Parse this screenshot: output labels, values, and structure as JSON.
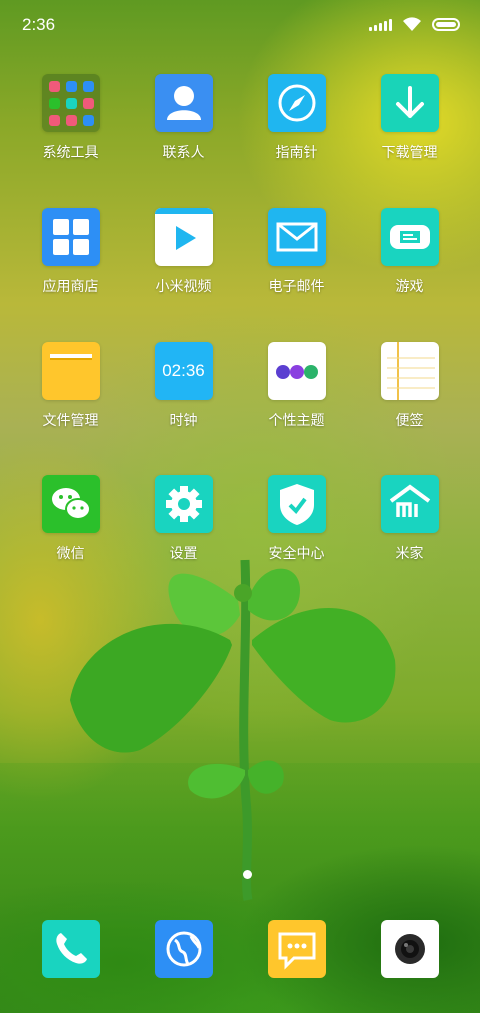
{
  "status_bar": {
    "time": "2:36",
    "icons": [
      "signal-icon",
      "wifi-icon",
      "battery-icon"
    ]
  },
  "apps": [
    {
      "label": "系统工具",
      "icon": "folder-icon",
      "color": "#4a6e1e"
    },
    {
      "label": "联系人",
      "icon": "person-icon",
      "color": "#3a8ff2"
    },
    {
      "label": "指南针",
      "icon": "compass-icon",
      "color": "#1fb6f0"
    },
    {
      "label": "下载管理",
      "icon": "download-arrow-icon",
      "color": "#19d4b8"
    },
    {
      "label": "应用商店",
      "icon": "app-grid-icon",
      "color": "#2d8ff5"
    },
    {
      "label": "小米视频",
      "icon": "play-icon",
      "color": "#ffffff"
    },
    {
      "label": "电子邮件",
      "icon": "envelope-icon",
      "color": "#1fb6f0"
    },
    {
      "label": "游戏",
      "icon": "gamepad-icon",
      "color": "#19d4c0"
    },
    {
      "label": "文件管理",
      "icon": "file-folder-icon",
      "color": "#ffc62c"
    },
    {
      "label": "时钟",
      "icon": "clock-icon",
      "color": "#21b5f5",
      "text": "02:36"
    },
    {
      "label": "个性主题",
      "icon": "theme-dots-icon",
      "color": "#ffffff"
    },
    {
      "label": "便签",
      "icon": "notepad-icon",
      "color": "#ffffff"
    },
    {
      "label": "微信",
      "icon": "wechat-icon",
      "color": "#2bc02b"
    },
    {
      "label": "设置",
      "icon": "gear-icon",
      "color": "#19d4c0"
    },
    {
      "label": "安全中心",
      "icon": "shield-icon",
      "color": "#19d4c0"
    },
    {
      "label": "米家",
      "icon": "mi-home-icon",
      "color": "#19d4c0"
    }
  ],
  "dock": [
    {
      "icon": "phone-icon",
      "color": "#19d4c0"
    },
    {
      "icon": "globe-icon",
      "color": "#2d8ff5"
    },
    {
      "icon": "message-icon",
      "color": "#ffc62c"
    },
    {
      "icon": "camera-icon",
      "color": "#ffffff"
    }
  ],
  "page_indicator": {
    "current": 1,
    "total": 1
  }
}
